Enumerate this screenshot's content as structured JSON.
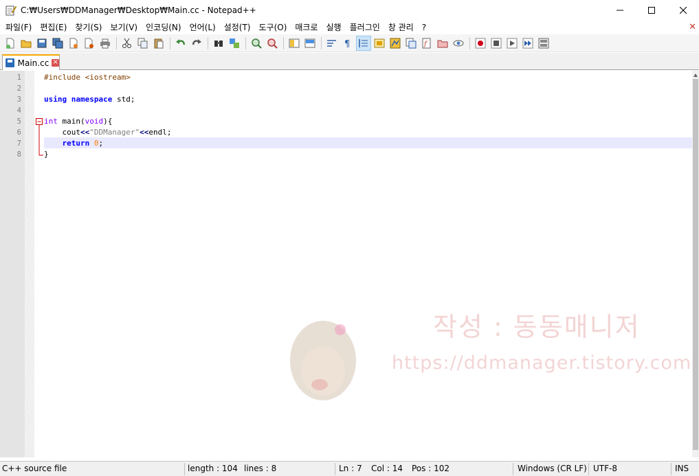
{
  "window": {
    "title": "C:₩Users₩DDManager₩Desktop₩Main.cc - Notepad++",
    "icon": "notepad-icon"
  },
  "menu": {
    "items": [
      "파일(F)",
      "편집(E)",
      "찾기(S)",
      "보기(V)",
      "인코딩(N)",
      "언어(L)",
      "설정(T)",
      "도구(O)",
      "매크로",
      "실행",
      "플러그인",
      "창 관리",
      "?"
    ],
    "close_glyph": "✕"
  },
  "tab": {
    "label": "Main.cc",
    "close": "×"
  },
  "editor": {
    "line_numbers": [
      "1",
      "2",
      "3",
      "4",
      "5",
      "6",
      "7",
      "8"
    ],
    "caret_line": 7,
    "lines": [
      {
        "pre": "#include <iostream>"
      },
      {},
      {
        "kw": "using",
        "kw2": "namespace",
        "text": "std;"
      },
      {},
      {
        "kw2": "int",
        "text1": "main(",
        "kw3": "void",
        "text2": "){"
      },
      {
        "text1": "cout",
        "op1": "<<",
        "str": "\"DDManager\"",
        "op2": "<<",
        "text2": "endl;"
      },
      {
        "kw": "return",
        "num": "0",
        "text": ";"
      },
      {
        "text": "}"
      }
    ]
  },
  "watermark": {
    "title": "작성 : 동동매니저",
    "url": "https://ddmanager.tistory.com"
  },
  "status": {
    "file_type": "C++ source file",
    "length": "length : 104",
    "lines": "lines : 8",
    "ln": "Ln : 7",
    "col": "Col : 14",
    "pos": "Pos : 102",
    "eol": "Windows (CR LF)",
    "encoding": "UTF-8",
    "mode": "INS"
  }
}
